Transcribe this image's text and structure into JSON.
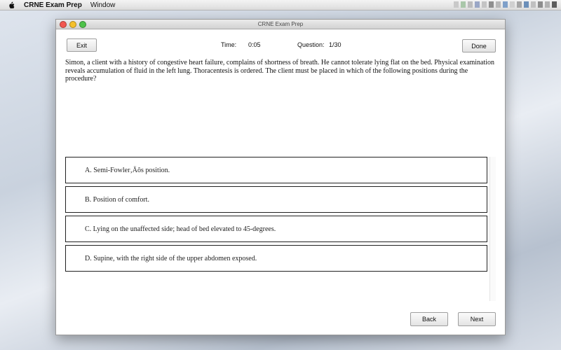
{
  "menubar": {
    "app_name": "CRNE Exam Prep",
    "items": [
      "Window"
    ]
  },
  "window": {
    "title": "CRNE Exam Prep"
  },
  "toolbar": {
    "exit_label": "Exit",
    "done_label": "Done",
    "time_label": "Time:",
    "time_value": "0:05",
    "question_label": "Question:",
    "question_value": "1/30"
  },
  "question": {
    "text": "Simon, a client with a history of congestive heart failure, complains of shortness of breath. He cannot tolerate lying flat on the bed. Physical examination reveals accumulation of fluid in the left lung. Thoracentesis is ordered. The client must be placed in which of the following positions during the procedure?"
  },
  "options": [
    {
      "label": "A. Semi-Fowler‚Äôs position."
    },
    {
      "label": "B. Position of comfort."
    },
    {
      "label": "C. Lying on the unaffected side; head of bed elevated to 45-degrees."
    },
    {
      "label": "D. Supine, with the right side of the upper abdomen exposed."
    }
  ],
  "footer": {
    "back_label": "Back",
    "next_label": "Next"
  },
  "icons": {
    "apple": "apple-icon",
    "close": "close-window-icon",
    "minimize": "minimize-window-icon",
    "zoom": "zoom-window-icon"
  },
  "colors": {
    "close": "#f2564f",
    "minimize": "#f5c02b",
    "zoom": "#4ec24a"
  }
}
